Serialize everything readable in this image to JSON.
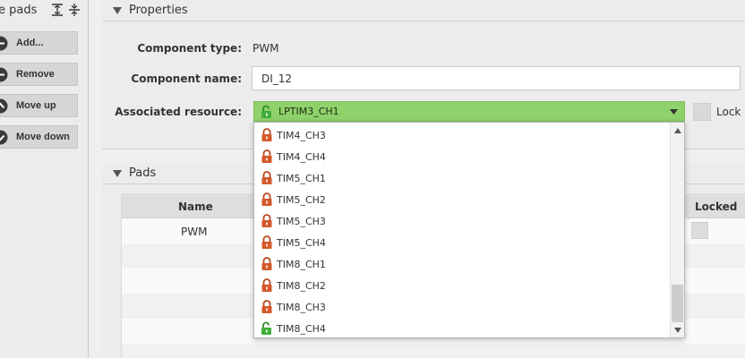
{
  "left_panel": {
    "title": "ee pads",
    "buttons": [
      {
        "label": "Add..."
      },
      {
        "label": "Remove"
      },
      {
        "label": "Move up"
      },
      {
        "label": "Move down"
      }
    ]
  },
  "properties": {
    "title": "Properties",
    "component_type_label": "Component type:",
    "component_type_value": "PWM",
    "component_name_label": "Component name:",
    "component_name_value": "DI_12",
    "associated_resource_label": "Associated resource:",
    "associated_resource_value": "LPTIM3_CH1",
    "associated_resource_locked": false,
    "lock_label": "Lock"
  },
  "resource_dropdown": {
    "items": [
      {
        "label": "TIM4_CH3",
        "locked": true
      },
      {
        "label": "TIM4_CH4",
        "locked": true
      },
      {
        "label": "TIM5_CH1",
        "locked": true
      },
      {
        "label": "TIM5_CH2",
        "locked": true
      },
      {
        "label": "TIM5_CH3",
        "locked": true
      },
      {
        "label": "TIM5_CH4",
        "locked": true
      },
      {
        "label": "TIM8_CH1",
        "locked": true
      },
      {
        "label": "TIM8_CH2",
        "locked": true
      },
      {
        "label": "TIM8_CH3",
        "locked": true
      },
      {
        "label": "TIM8_CH4",
        "locked": false
      }
    ]
  },
  "pads": {
    "title": "Pads",
    "columns": {
      "name": "Name",
      "locked": "Locked"
    },
    "rows": [
      {
        "name": "PWM"
      }
    ]
  },
  "colors": {
    "selected_resource_bg": "#8fd16b",
    "locked_icon": "#d4582a",
    "unlocked_icon": "#3fae3a"
  },
  "icons": {
    "locked": "locked-padlock-icon",
    "unlocked": "unlocked-padlock-icon",
    "expand_all": "expand-all-icon",
    "collapse_all": "collapse-all-icon",
    "add": "add-icon",
    "remove": "remove-icon",
    "move_up": "move-up-icon",
    "move_down": "move-down-icon"
  }
}
